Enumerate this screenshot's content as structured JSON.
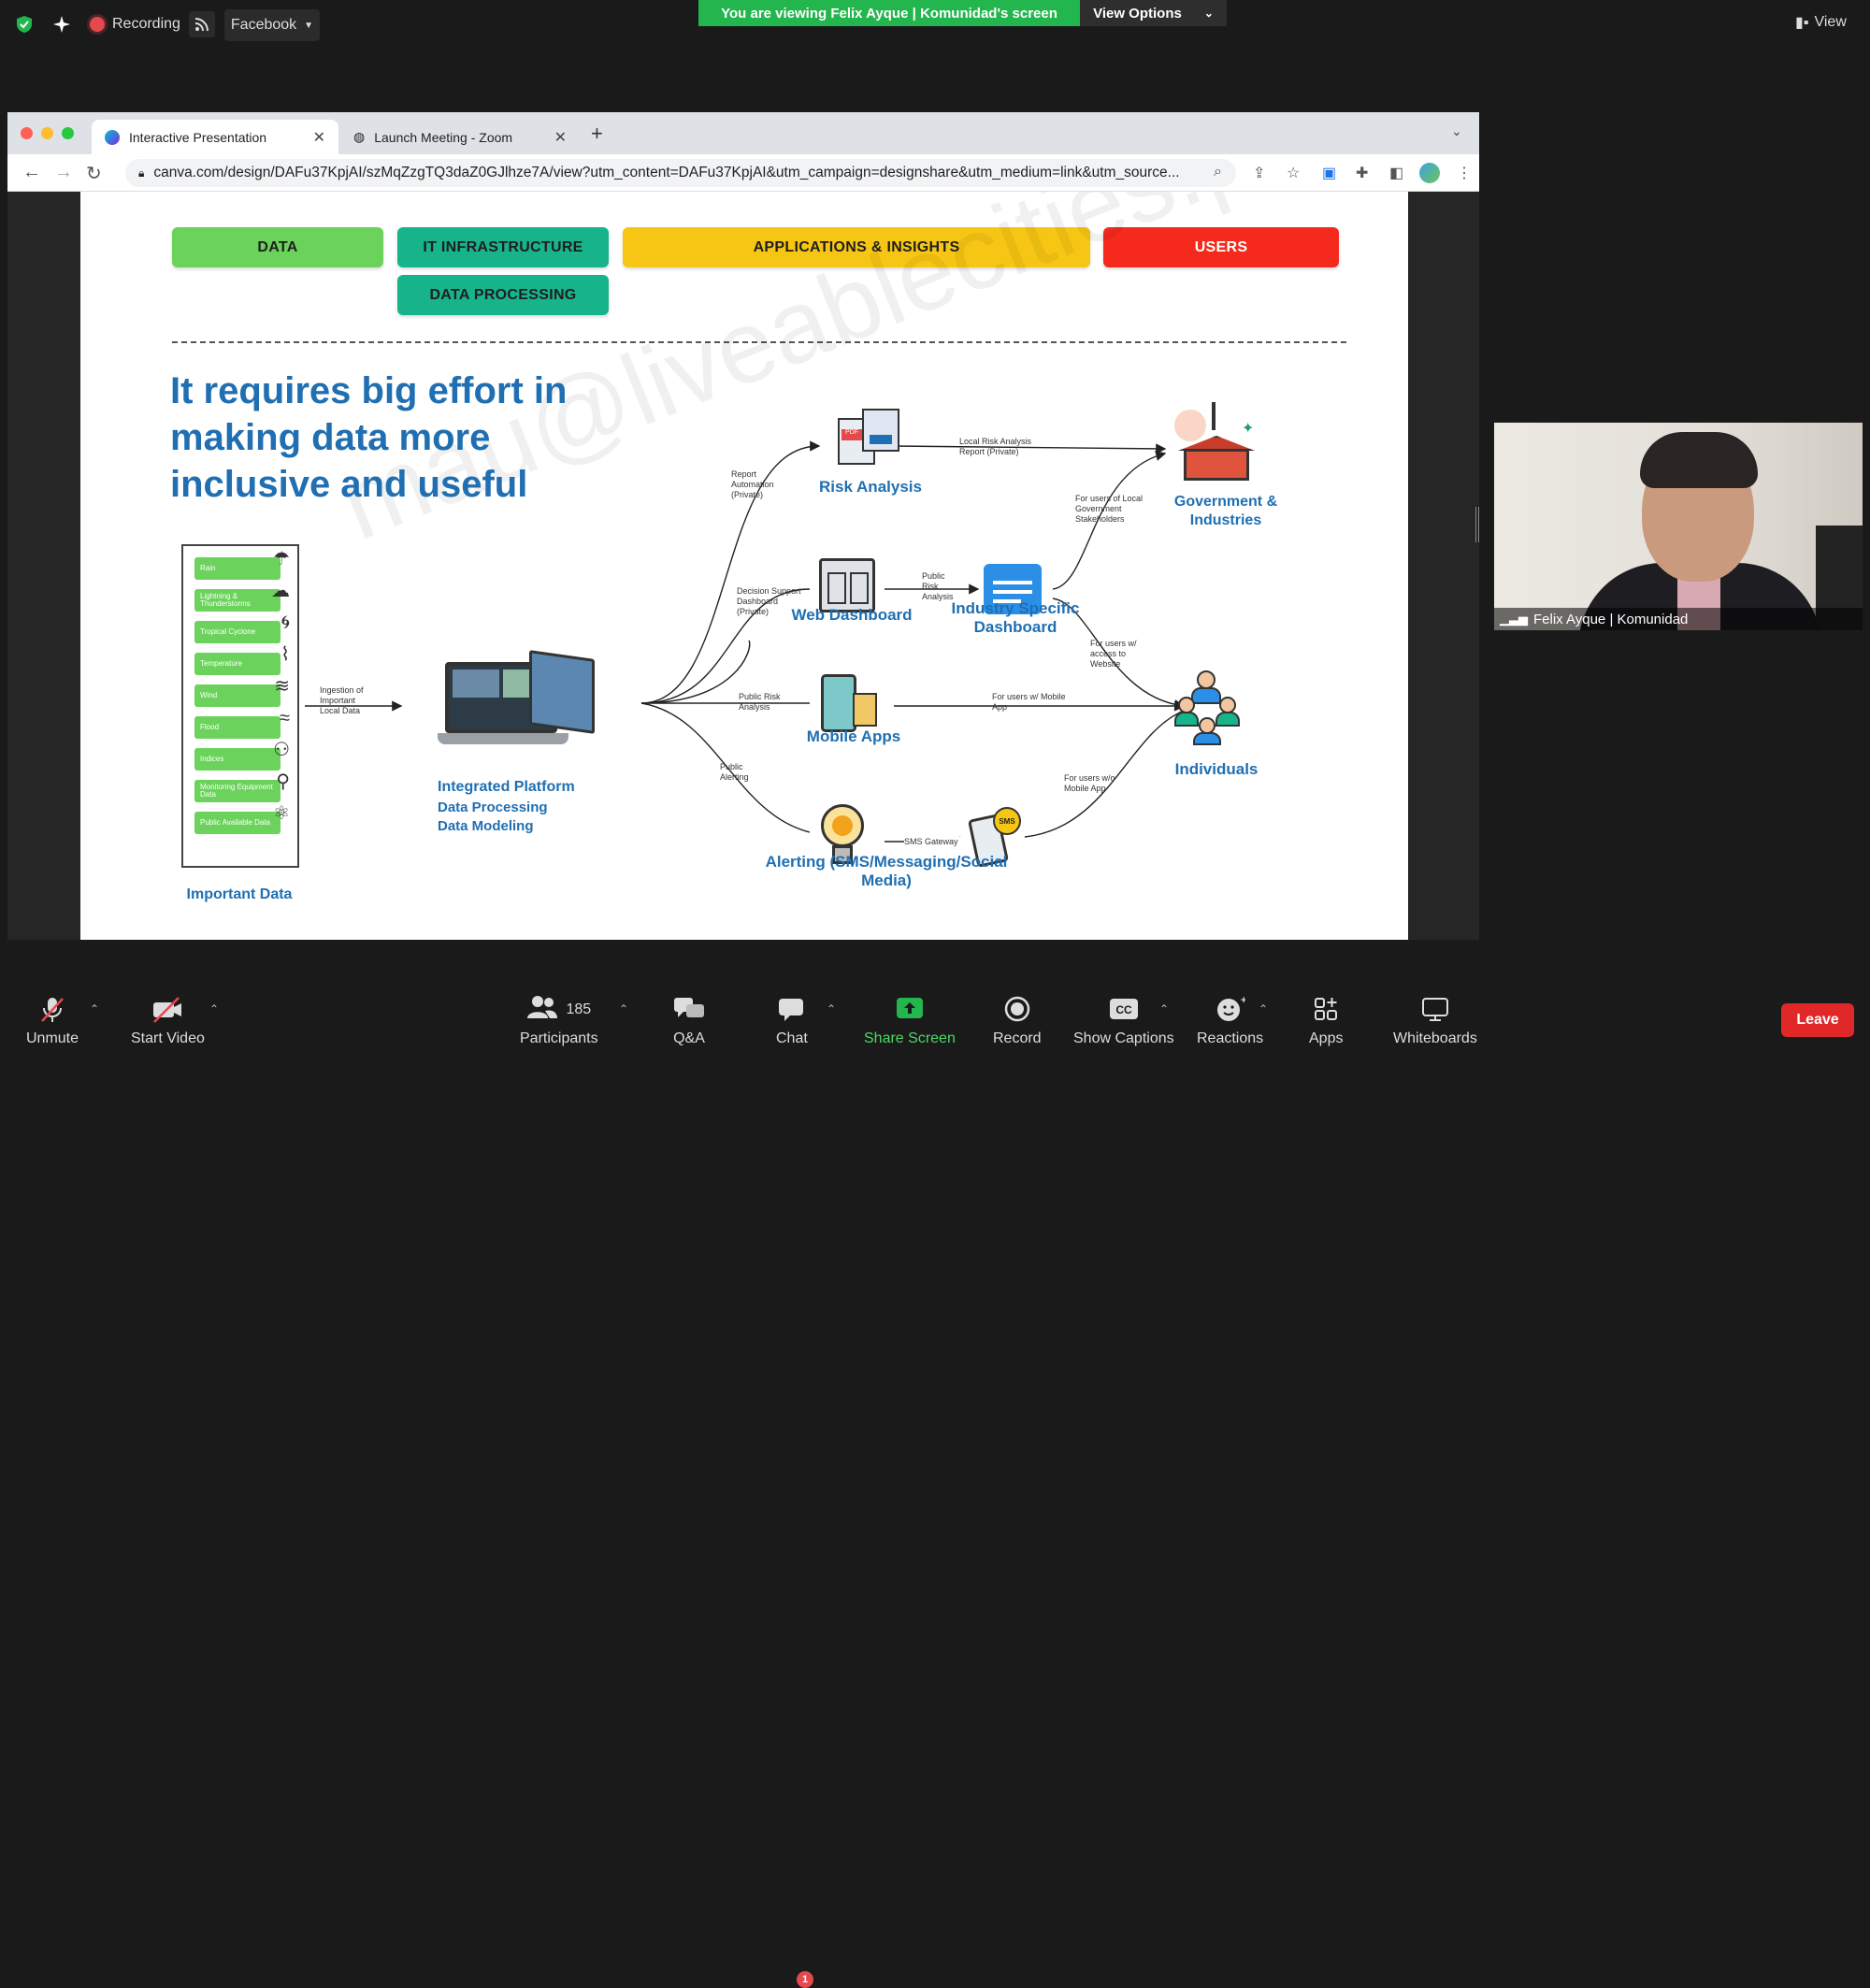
{
  "topbar": {
    "recording_label": "Recording",
    "stream_button": "Facebook",
    "viewing_banner": "You are viewing Felix Ayque | Komunidad's screen",
    "view_options": "View Options",
    "view_label": "View"
  },
  "browser": {
    "tabs": [
      {
        "label": "Interactive Presentation"
      },
      {
        "label": "Launch Meeting - Zoom"
      }
    ],
    "url": "canva.com/design/DAFu37KpjAI/szMqZzgTQ3daZ0GJlhze7A/view?utm_content=DAFu37KpjAI&utm_campaign=designshare&utm_medium=link&utm_source..."
  },
  "slide": {
    "categories": {
      "data": "DATA",
      "it_infrastructure": "IT INFRASTRUCTURE",
      "data_processing": "DATA PROCESSING",
      "applications": "APPLICATIONS & INSIGHTS",
      "users": "USERS"
    },
    "headline": "It requires big effort in making data more inclusive and useful",
    "watermark": "mau@liveablecities.ph",
    "data_items": [
      "Rain",
      "Lightning & Thunderstorms",
      "Tropical Cyclone",
      "Temperature",
      "Wind",
      "Flood",
      "Indices",
      "Monitoring Equipment Data",
      "Public Available Data"
    ],
    "important_data": "Important Data",
    "ingestion": "Ingestion of Important Local Data",
    "platform": {
      "line1": "Integrated Platform",
      "line2": "Data Processing",
      "line3": "Data Modeling"
    },
    "apps": {
      "risk_analysis": "Risk Analysis",
      "web_dashboard": "Web Dashboard",
      "industry_dashboard": "Industry Specific Dashboard",
      "mobile_apps": "Mobile Apps",
      "alerting": "Alerting (SMS/Messaging/Social Media)"
    },
    "users": {
      "government": "Government & Industries",
      "individuals": "Individuals"
    },
    "edge_labels": {
      "report_automation": "Report Automation (Private)",
      "local_risk": "Local Risk Analysis Report (Private)",
      "decision_support": "Decision Support Dashboard (Private)",
      "public_risk": "Public Risk Analysis",
      "for_local_gov": "For users of Local Government Stakeholders",
      "for_web": "For users w/ access to Website",
      "public_risk2": "Public Risk Analysis",
      "for_mobile": "For users w/ Mobile App",
      "public_alerting": "Public Alerting",
      "sms_gateway": "SMS Gateway",
      "for_no_mobile": "For users w/o Mobile App",
      "sms": "SMS"
    }
  },
  "selfview": {
    "name": "Felix Ayque | Komunidad"
  },
  "toolbar": {
    "unmute": "Unmute",
    "start_video": "Start Video",
    "participants": "Participants",
    "participant_count": "185",
    "qa": "Q&A",
    "chat": "Chat",
    "chat_badge": "1",
    "share_screen": "Share Screen",
    "record": "Record",
    "show_captions": "Show Captions",
    "reactions": "Reactions",
    "apps": "Apps",
    "whiteboards": "Whiteboards",
    "leave": "Leave"
  },
  "colors": {
    "zoom_green": "#23b54e",
    "data_green": "#6bd35b",
    "infra_teal": "#17b38a",
    "apps_yellow": "#f7c614",
    "users_red": "#f52a1d",
    "slide_blue": "#1f6fb2",
    "leave_red": "#e02828"
  }
}
